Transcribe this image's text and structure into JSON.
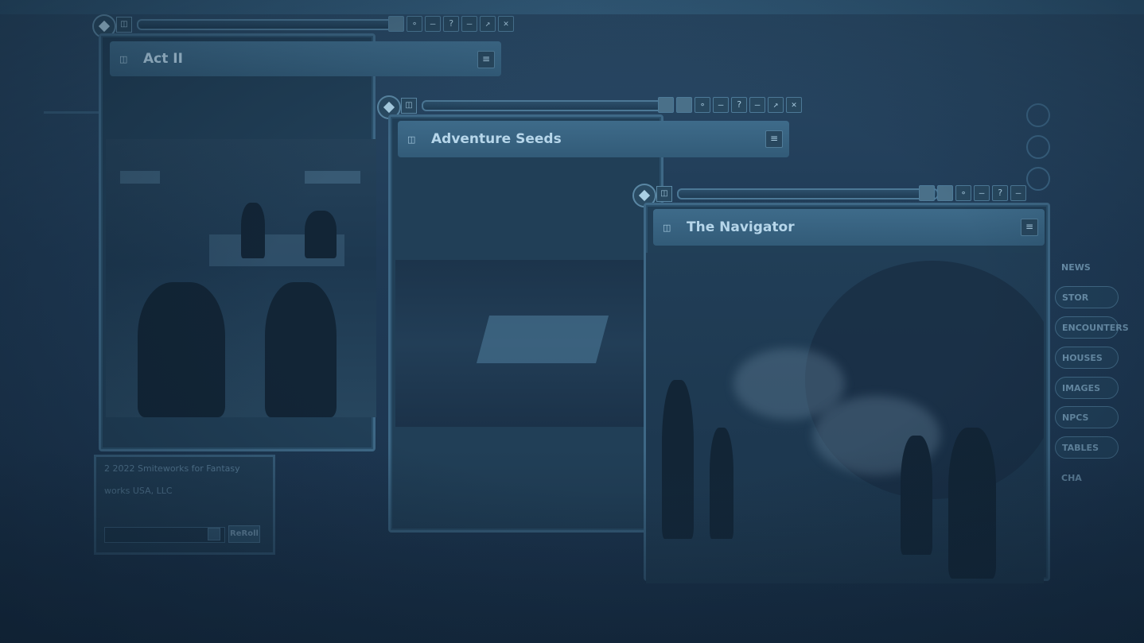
{
  "windows": {
    "act2": {
      "title": "Act II"
    },
    "seeds": {
      "title": "Adventure Seeds"
    },
    "navigator": {
      "title": "The Navigator"
    }
  },
  "chat": {
    "line1": "2 2022 Smiteworks for Fantasy",
    "line2": "works USA, LLC",
    "reroll_label": "ReRoll"
  },
  "sidebar": {
    "items": [
      "NEWS",
      "STOR",
      "ENCOUNTERS",
      "HOUSES",
      "IMAGES",
      "NPCS",
      "TABLES",
      "CHA"
    ]
  },
  "icons": {
    "lock": "diamond-lock-icon",
    "book": "book-icon",
    "menu": "menu-icon",
    "close": "close-icon",
    "expand": "expand-icon",
    "minimize": "minimize-icon",
    "help": "help-icon"
  },
  "colors": {
    "background": "#1f3a55",
    "header": "#3e6b8a",
    "frame": "#3e6886"
  }
}
